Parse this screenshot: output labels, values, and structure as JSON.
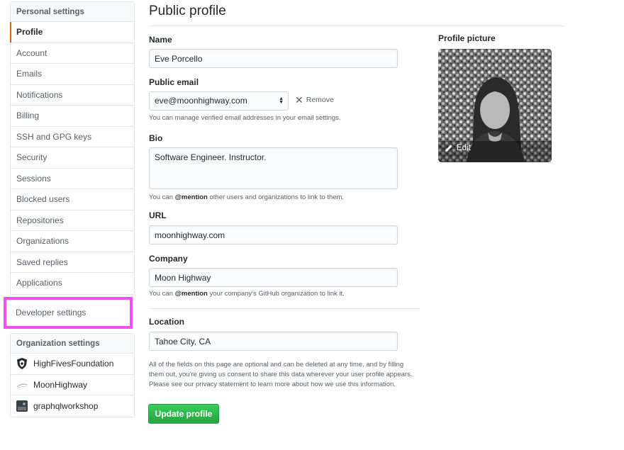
{
  "sidebar": {
    "heading": "Personal settings",
    "items": [
      {
        "label": "Profile",
        "selected": true
      },
      {
        "label": "Account"
      },
      {
        "label": "Emails"
      },
      {
        "label": "Notifications"
      },
      {
        "label": "Billing"
      },
      {
        "label": "SSH and GPG keys"
      },
      {
        "label": "Security"
      },
      {
        "label": "Sessions"
      },
      {
        "label": "Blocked users"
      },
      {
        "label": "Repositories"
      },
      {
        "label": "Organizations"
      },
      {
        "label": "Saved replies"
      },
      {
        "label": "Applications"
      }
    ],
    "developer_settings": "Developer settings",
    "highlight_color": "#f24ff2",
    "org_heading": "Organization settings",
    "orgs": [
      {
        "label": "HighFivesFoundation",
        "icon": "shield-logo-icon"
      },
      {
        "label": "MoonHighway",
        "icon": "moon-logo-icon"
      },
      {
        "label": "graphqlworkshop",
        "icon": "photo-avatar-icon"
      }
    ]
  },
  "main": {
    "title": "Public profile",
    "name_label": "Name",
    "name_value": "Eve Porcello",
    "public_email_label": "Public email",
    "public_email_value": "eve@moonhighway.com",
    "remove_label": "Remove",
    "email_note": "You can manage verified email addresses in your email settings.",
    "bio_label": "Bio",
    "bio_value": "Software Engineer. Instructor.",
    "bio_note_pre": "You can ",
    "bio_note_mention": "@mention",
    "bio_note_post": " other users and organizations to link to them.",
    "url_label": "URL",
    "url_value": "moonhighway.com",
    "company_label": "Company",
    "company_value": "Moon Highway",
    "company_note_pre": "You can ",
    "company_note_mention": "@mention",
    "company_note_post": " your company's GitHub organization to link it.",
    "location_label": "Location",
    "location_value": "Tahoe City, CA",
    "privacy_note": "All of the fields on this page are optional and can be deleted at any time, and by filling them out, you're giving us consent to share this data wherever your user profile appears. Please see our privacy statement to learn more about how we use this information.",
    "update_button": "Update profile",
    "button_color": "#2ea44f"
  },
  "profile_picture": {
    "label": "Profile picture",
    "edit_label": "Edit"
  }
}
